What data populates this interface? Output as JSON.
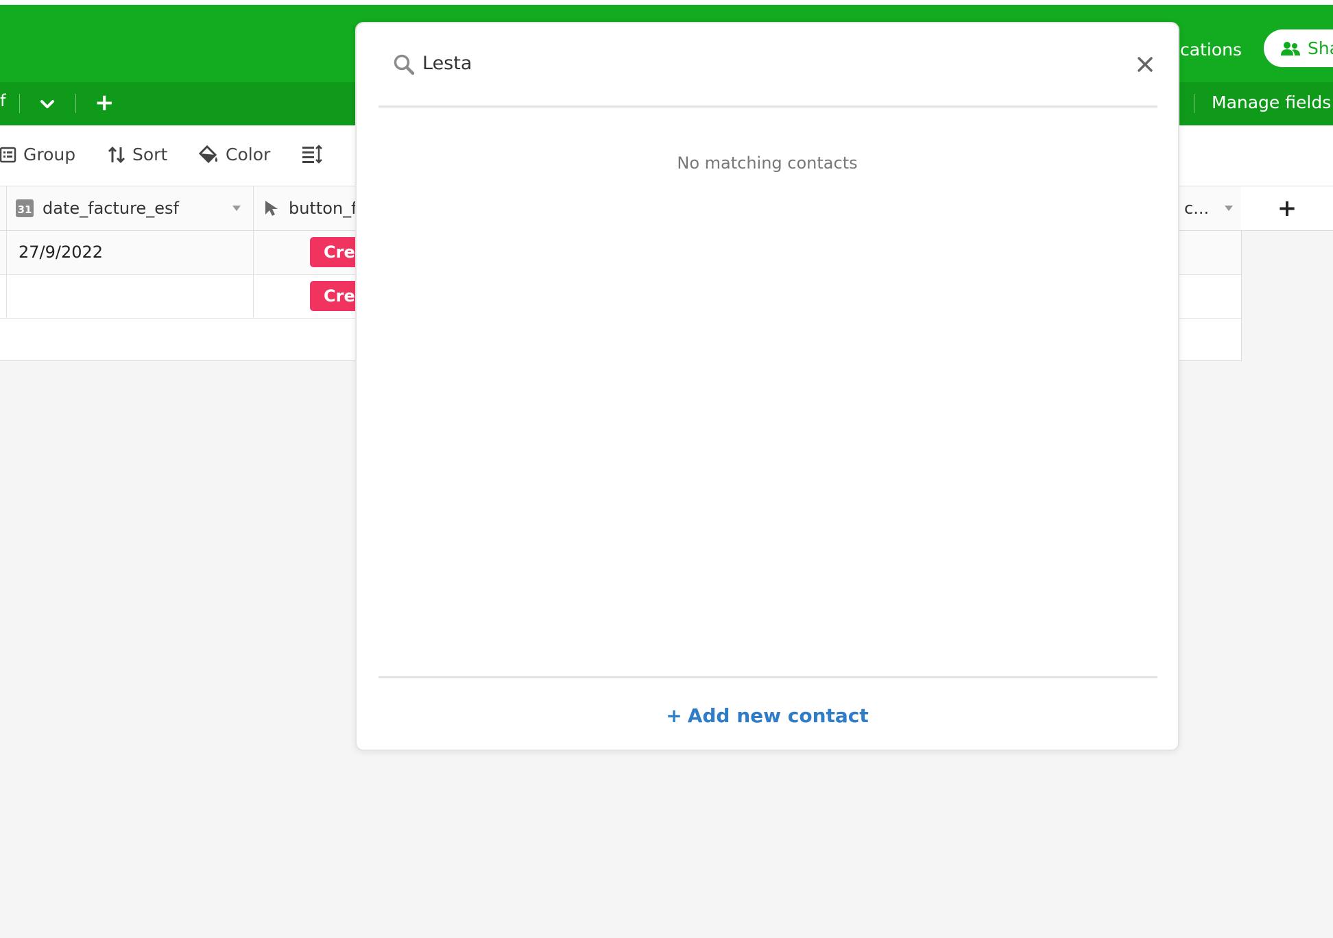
{
  "header": {
    "notifications_fragment": "cations",
    "share_label": "Sha",
    "tab_fragment": "f",
    "add_label": "+",
    "manage_fields_label": "Manage fields"
  },
  "toolbar": {
    "group_label": "Group",
    "sort_label": "Sort",
    "color_label": "Color"
  },
  "grid": {
    "columns": [
      {
        "label": "date_facture_esf",
        "icon": "calendar-icon",
        "icon_text": "31"
      },
      {
        "label": "button_f",
        "icon": "cursor-icon"
      },
      {
        "label": "c...",
        "icon": ""
      }
    ],
    "rows": [
      {
        "date_facture_esf": "27/9/2022",
        "button_label": "Cree"
      },
      {
        "date_facture_esf": "",
        "button_label": "Cree"
      }
    ],
    "add_column_label": "+"
  },
  "modal": {
    "search_value": "Lesta",
    "empty_message": "No matching contacts",
    "add_contact_label": "Add new contact",
    "add_contact_plus": "+"
  },
  "colors": {
    "header_green": "#13ab1f",
    "subbar_green": "#109a1a",
    "button_pink": "#f0335f",
    "link_blue": "#2f7cc7"
  }
}
